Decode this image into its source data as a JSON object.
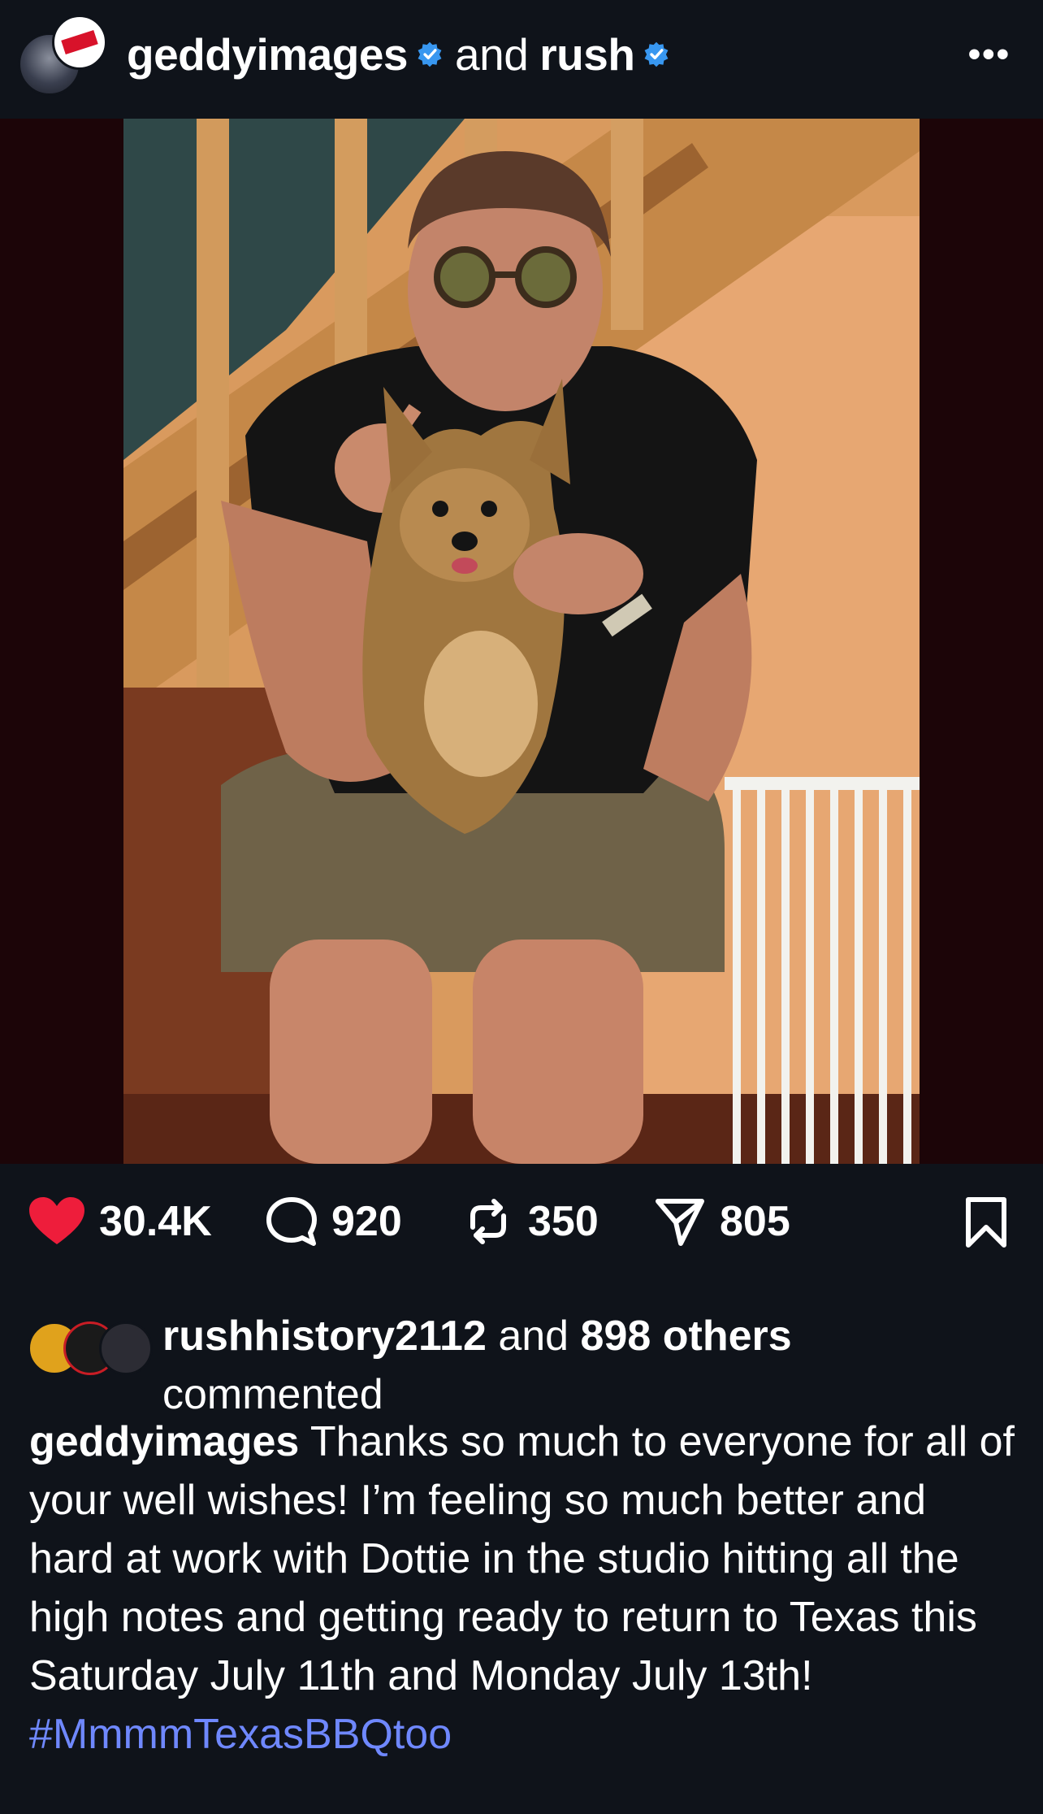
{
  "header": {
    "account": "geddyimages",
    "conjunction": "and",
    "collaborator": "rush",
    "menu_icon": "more-horizontal-icon",
    "verified_icon": "verified-badge-icon"
  },
  "post": {
    "image_alt_icon": "post-photo",
    "likes": "30.4K",
    "comments": "920",
    "reposts": "350",
    "shares": "805",
    "icons": {
      "like": "heart-filled-icon",
      "comment": "comment-bubble-icon",
      "repost": "repost-icon",
      "share": "paper-plane-icon",
      "save": "bookmark-icon"
    },
    "colors": {
      "heart": "#ee1d3b",
      "hashtag": "#6f88ff",
      "background": "#0f131a"
    }
  },
  "commented": {
    "user": "rushhistory2112",
    "and": "and",
    "others": "898 others",
    "suffix": "commented"
  },
  "caption": {
    "author": "geddyimages",
    "text": "Thanks so much to everyone for all of your well wishes! I’m feeling so much better and hard at work with Dottie in the studio hitting all the high notes and getting ready to return to Texas this Saturday July 11th and Monday July 13th!",
    "hashtag": "#MmmmTexasBBQtoo"
  }
}
